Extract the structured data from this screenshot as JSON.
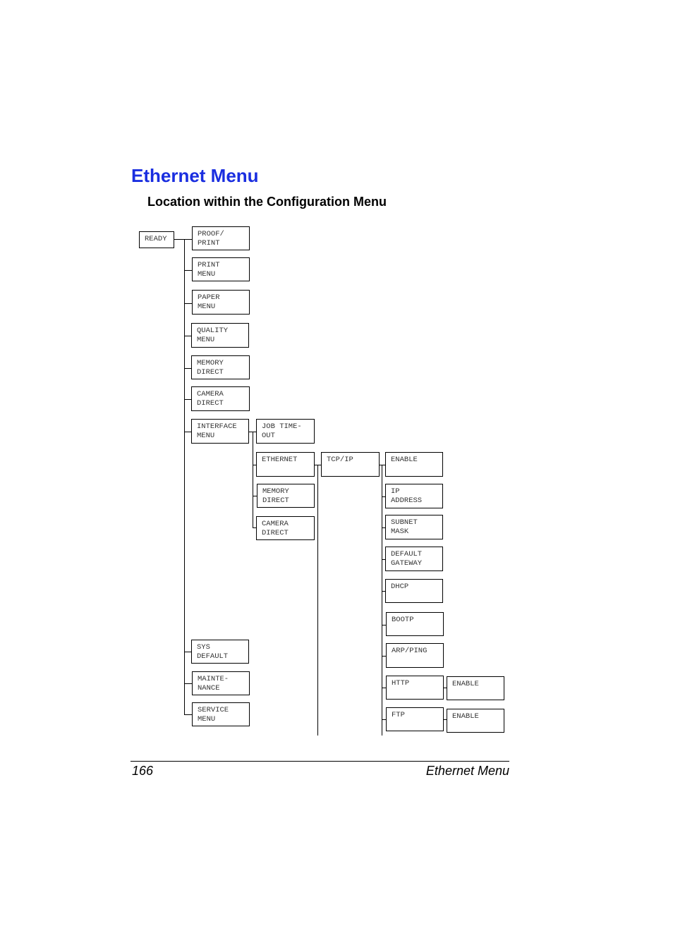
{
  "heading": {
    "title": "Ethernet Menu",
    "subtitle": "Location within the Configuration Menu"
  },
  "menu": {
    "ready": "READY",
    "level1": [
      "PROOF/\nPRINT",
      "PRINT\nMENU",
      "PAPER\nMENU",
      "QUALITY\nMENU",
      "MEMORY\nDIRECT",
      "CAMERA\nDIRECT",
      "INTERFACE\nMENU",
      "SYS\nDEFAULT",
      "MAINTE-\nNANCE",
      "SERVICE\nMENU"
    ],
    "interface": [
      "JOB TIME-\nOUT",
      "ETHERNET",
      "MEMORY\nDIRECT",
      "CAMERA\nDIRECT"
    ],
    "ethernet": [
      "TCP/IP"
    ],
    "tcpip": [
      "ENABLE",
      "IP\nADDRESS",
      "SUBNET\nMASK",
      "DEFAULT\nGATEWAY",
      "DHCP",
      "BOOTP",
      "ARP/PING",
      "HTTP",
      "FTP"
    ],
    "http": [
      "ENABLE"
    ],
    "ftp": [
      "ENABLE"
    ]
  },
  "footer": {
    "page_number": "166",
    "section": "Ethernet Menu"
  }
}
